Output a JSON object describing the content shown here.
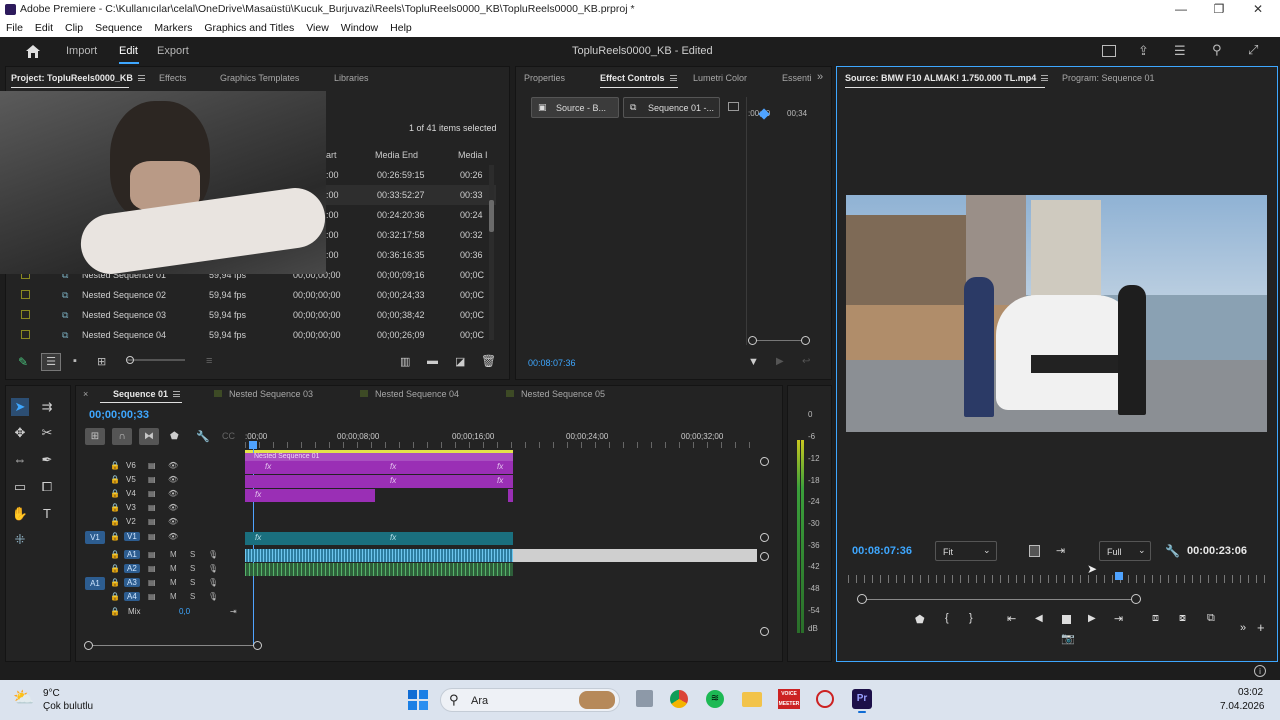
{
  "window": {
    "title": "Adobe Premiere - C:\\Kullanıcılar\\celal\\OneDrive\\Masaüstü\\Kucuk_Burjuvazi\\Reels\\TopluReels0000_KB\\TopluReels0000_KB.prproj *",
    "minimize": "—",
    "maximize": "❐",
    "close": "✕"
  },
  "menu": [
    "File",
    "Edit",
    "Clip",
    "Sequence",
    "Markers",
    "Graphics and Titles",
    "View",
    "Window",
    "Help"
  ],
  "header": {
    "home_icon": "home-icon",
    "tabs": [
      "Import",
      "Edit",
      "Export"
    ],
    "active_tab": "Edit",
    "project_name": "TopluReels0000_KB - Edited"
  },
  "project_panel": {
    "tabs": [
      "Project: TopluReels0000_KB",
      "Effects",
      "Graphics Templates",
      "Libraries"
    ],
    "selection_info": "1 of 41 items selected",
    "columns": [
      "art",
      "Media End",
      "Media I"
    ],
    "top_rows": [
      {
        "start": ":00",
        "end": "00:26:59:15",
        "dur": "00:26"
      },
      {
        "start": ":00",
        "end": "00:33:52:27",
        "dur": "00:33"
      },
      {
        "start": ":00",
        "end": "00:24:20:36",
        "dur": "00:24"
      },
      {
        "start": ":00",
        "end": "00:32:17:58",
        "dur": "00:32"
      },
      {
        "start": ":00",
        "end": "00:36:16:35",
        "dur": "00:36"
      }
    ],
    "sequence_rows": [
      {
        "name": "Nested Sequence 01",
        "fps": "59,94 fps",
        "start": "00;00;00;00",
        "end": "00;00;09;16",
        "dur": "00;0C"
      },
      {
        "name": "Nested Sequence 02",
        "fps": "59,94 fps",
        "start": "00;00;00;00",
        "end": "00;00;24;33",
        "dur": "00;0C"
      },
      {
        "name": "Nested Sequence 03",
        "fps": "59,94 fps",
        "start": "00;00;00;00",
        "end": "00;00;38;42",
        "dur": "00;0C"
      },
      {
        "name": "Nested Sequence 04",
        "fps": "59,94 fps",
        "start": "00;00;00;00",
        "end": "00;00;26;09",
        "dur": "00;0C"
      }
    ]
  },
  "effect_controls": {
    "tabs": [
      "Properties",
      "Effect Controls",
      "Lumetri Color",
      "Essenti"
    ],
    "source_btn": "Source - B...",
    "sequence_btn": "Sequence 01 -...",
    "ruler": [
      ":00;00",
      "00;34"
    ],
    "timecode": "00:08:07:36"
  },
  "source_monitor": {
    "tabs": [
      "Source: BMW F10 ALMAK! 1.750.000 TL.mp4",
      "Program: Sequence 01"
    ],
    "timecode": "00:08:07:36",
    "fit": "Fit",
    "quality": "Full",
    "duration": "00:00:23:06"
  },
  "timeline": {
    "tabs": [
      "Sequence 01",
      "Nested Sequence 03",
      "Nested Sequence 04",
      "Nested Sequence 05"
    ],
    "timecode": "00;00;00;33",
    "ruler": [
      ":00;00",
      "00;00;08;00",
      "00;00;16;00",
      "00;00;24;00",
      "00;00;32;00"
    ],
    "video_tracks": [
      "V6",
      "V5",
      "V4",
      "V3",
      "V2",
      "V1"
    ],
    "audio_tracks": [
      "A1",
      "A2",
      "A3",
      "A4"
    ],
    "source_v": "V1",
    "source_a": "A1",
    "mix_label": "Mix",
    "mix_value": "0,0",
    "nested_label": "Nested Sequence 01",
    "fx": "fx",
    "m": "M",
    "s": "S"
  },
  "audio_meter": {
    "labels": [
      "0",
      "-6",
      "-12",
      "-18",
      "-24",
      "-30",
      "-36",
      "-42",
      "-48",
      "-54",
      "dB"
    ]
  },
  "taskbar": {
    "temp": "9°C",
    "weather": "Çok bulutlu",
    "search": "Ara",
    "time": "03:02",
    "date": "7.04.2026",
    "voicemeeter": "VOICE MEETER"
  },
  "colors": {
    "accent_blue": "#3ea7ff",
    "clip_purple": "#9a2fb5",
    "clip_teal": "#1a6f7e",
    "audio_clip": "#2e7ea0",
    "playhead": "#4fa3ff"
  }
}
